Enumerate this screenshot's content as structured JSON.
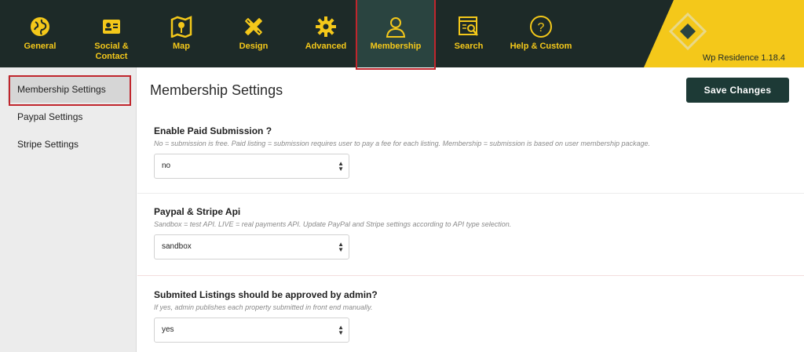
{
  "nav": {
    "items": [
      {
        "label": "General",
        "icon": "globe-icon"
      },
      {
        "label": "Social &\nContact",
        "icon": "contact-card-icon"
      },
      {
        "label": "Map",
        "icon": "map-pin-icon"
      },
      {
        "label": "Design",
        "icon": "pencil-ruler-icon"
      },
      {
        "label": "Advanced",
        "icon": "gear-icon"
      },
      {
        "label": "Membership",
        "icon": "user-icon"
      },
      {
        "label": "Search",
        "icon": "search-document-icon"
      },
      {
        "label": "Help & Custom",
        "icon": "question-icon"
      }
    ],
    "active": "Membership",
    "version": "Wp Residence 1.18.4"
  },
  "sidebar": {
    "items": [
      {
        "label": "Membership Settings"
      },
      {
        "label": "Paypal Settings"
      },
      {
        "label": "Stripe Settings"
      }
    ],
    "active": "Membership Settings"
  },
  "main": {
    "title": "Membership Settings",
    "save_label": "Save Changes",
    "settings": [
      {
        "title": "Enable Paid Submission ?",
        "desc": "No = submission is free. Paid listing = submission requires user to pay a fee for each listing. Membership = submission is based on user membership package.",
        "value": "no"
      },
      {
        "title": "Paypal & Stripe Api",
        "desc": "Sandbox = test API. LIVE = real payments API. Update PayPal and Stripe settings according to API type selection.",
        "value": "sandbox"
      },
      {
        "title": "Submited Listings should be approved by admin?",
        "desc": "If yes, admin publishes each property submitted in front end manually.",
        "value": "yes"
      }
    ]
  },
  "colors": {
    "nav_bg": "#1d2a28",
    "accent_yellow": "#f4c81a",
    "active_tab_bg": "#2a4440",
    "highlight_red": "#c0262d",
    "save_button_bg": "#1d3a36",
    "sidebar_bg": "#ececec"
  }
}
